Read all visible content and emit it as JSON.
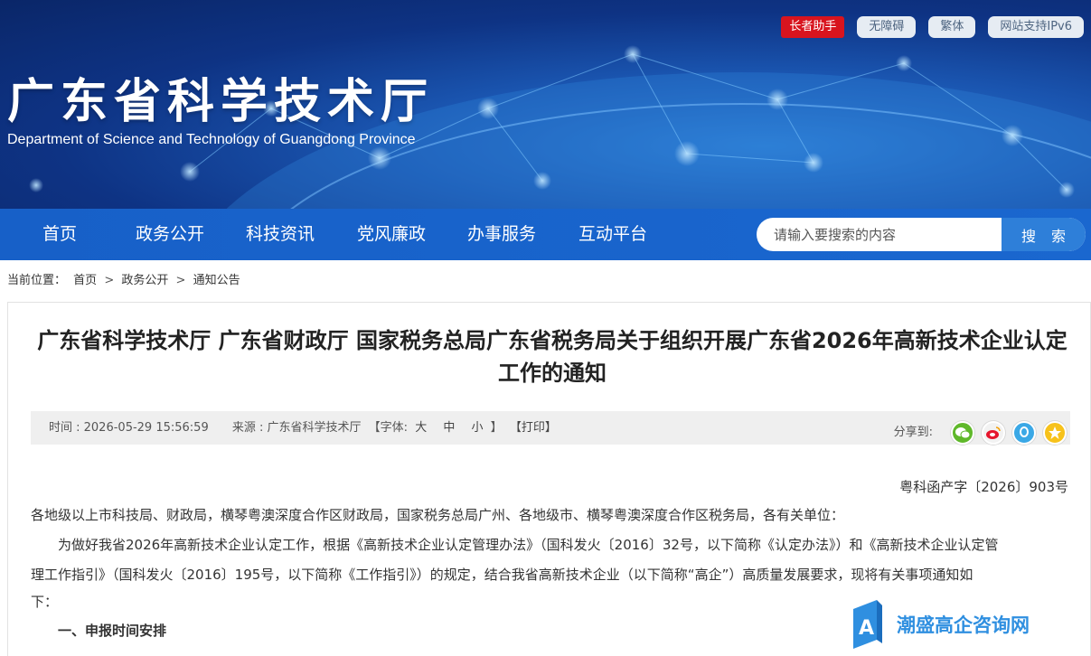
{
  "header": {
    "site_title": "广东省科学技术厅",
    "site_subtitle": "Department of Science and Technology of Guangdong Province",
    "tools": [
      "长者助手",
      "无障碍",
      "繁体",
      "网站支持IPv6"
    ]
  },
  "nav": {
    "items": [
      "首页",
      "政务公开",
      "科技资讯",
      "党风廉政",
      "办事服务",
      "互动平台"
    ],
    "search_placeholder": "请输入要搜索的内容",
    "search_button": "搜 索"
  },
  "breadcrumb": {
    "label": "当前位置：",
    "items": [
      "首页",
      "政务公开",
      "通知公告"
    ],
    "separator": ">"
  },
  "article": {
    "title": "广东省科学技术厅 广东省财政厅 国家税务总局广东省税务局关于组织开展广东省2026年高新技术企业认定工作的通知",
    "meta": {
      "time": "时间 : 2026-05-29 15:56:59",
      "source": "来源 : 广东省科学技术厅",
      "font_open": "【字体:",
      "font_sizes": [
        "大",
        "中",
        "小"
      ],
      "font_close": "】",
      "print": "【打印】",
      "share_label": "分享到:"
    },
    "share_icons": [
      "wechat-icon",
      "weibo-icon",
      "qq-icon",
      "qzone-icon"
    ],
    "doc_number": "粤科函产字〔2026〕903号",
    "addressee": "各地级以上市科技局、财政局，横琴粤澳深度合作区财政局，国家税务总局广州、各地级市、横琴粤澳深度合作区税务局，各有关单位：",
    "intro_line1": "为做好我省2026年高新技术企业认定工作，根据《高新技术企业认定管理办法》（国科发火〔2016〕32号，以下简称《认定办法》）和《高新技术企业认定管",
    "intro_line2": "理工作指引》（国科发火〔2016〕195号，以下简称《工作指引》）的规定，结合我省高新技术企业（以下简称“高企”）高质量发展要求，现将有关事项通知如",
    "intro_line3": "下：",
    "section1": "一、申报时间安排"
  },
  "watermark": {
    "text": "潮盛高企咨询网"
  },
  "colors": {
    "nav_bg": "#1a63cc",
    "search_button": "#2e7fd9",
    "elder_badge": "#d8141e",
    "watermark": "#2f8fe0"
  }
}
